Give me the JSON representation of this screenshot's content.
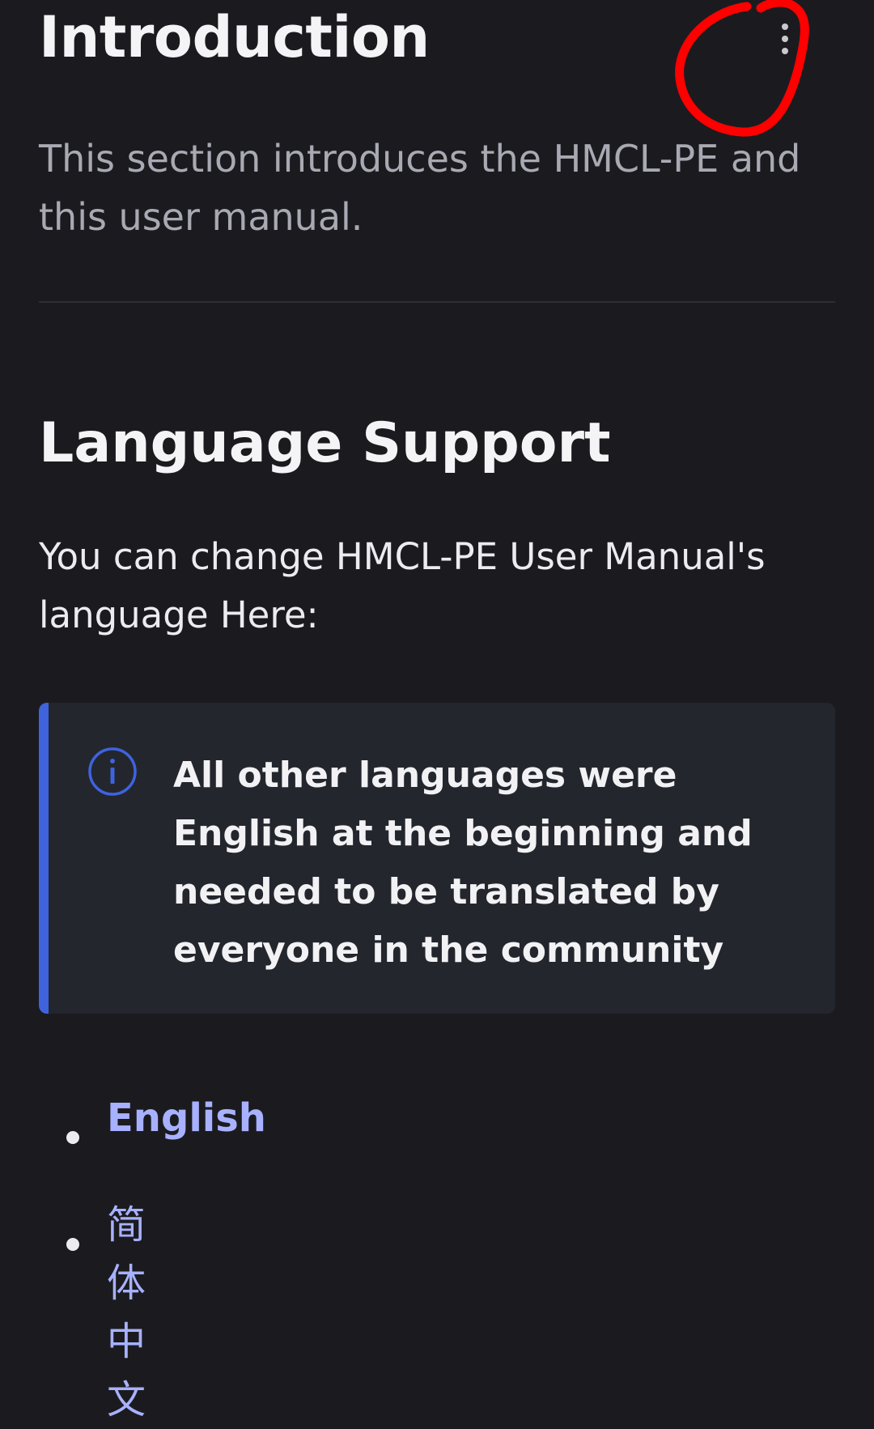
{
  "page": {
    "title": "Introduction",
    "description": "This section introduces the HMCL-PE and this user manual."
  },
  "section": {
    "title": "Language Support",
    "text": "You can change HMCL-PE User Manual's language Here:"
  },
  "info_box": {
    "text": "All other languages were English at the beginning and needed to be translated by everyone in the community"
  },
  "languages": [
    {
      "label": "English"
    },
    {
      "label": "简体中文"
    }
  ],
  "icons": {
    "more": "vertical-ellipsis-icon",
    "info": "info-circle-icon"
  },
  "colors": {
    "background": "#1b1b1f",
    "accent": "#3e63dd",
    "link": "#a8b1ff",
    "annotation": "#ff0000"
  }
}
